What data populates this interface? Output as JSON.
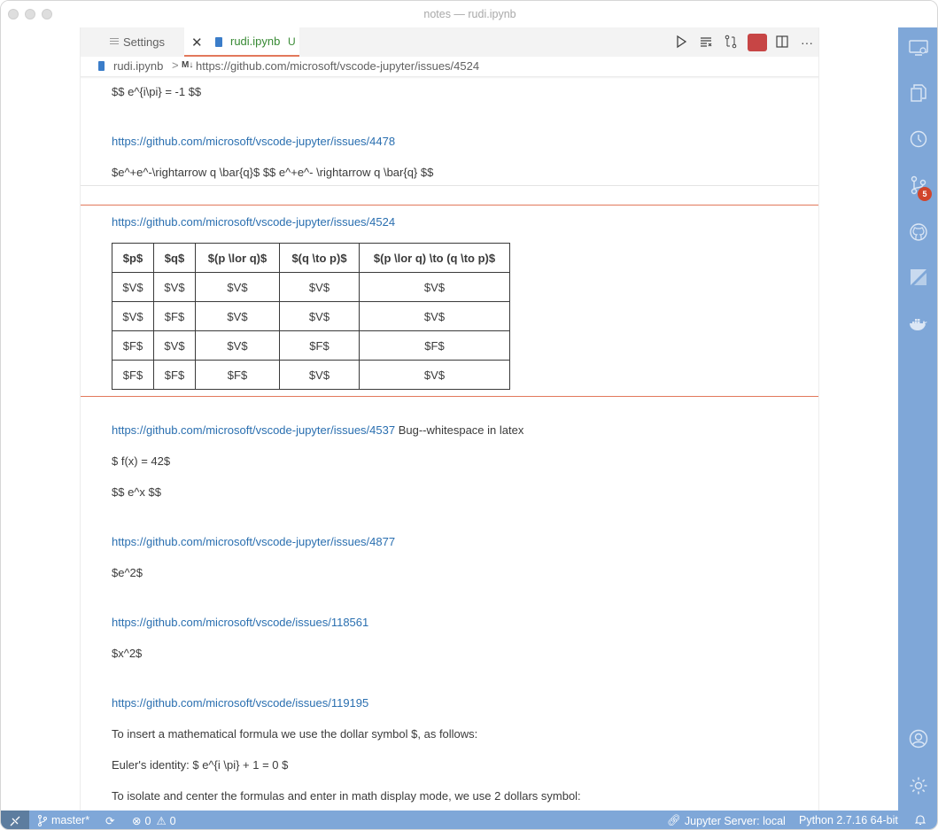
{
  "window": {
    "title": "notes — rudi.ipynb"
  },
  "tabs": [
    {
      "label": "Settings"
    },
    {
      "label": "rudi.ipynb",
      "badge": "U"
    }
  ],
  "breadcrumb": {
    "file": "rudi.ipynb",
    "separator": ">",
    "md_icon": "M↓",
    "path": "https://github.com/microsoft/vscode-jupyter/issues/4524"
  },
  "cells": {
    "c1_line1": "$$ e^{i\\pi} = -1 $$",
    "c1_link": "https://github.com/microsoft/vscode-jupyter/issues/4478",
    "c1_line2": "$e^+e^-\\rightarrow q \\bar{q}$ $$ e^+e^- \\rightarrow q \\bar{q} $$",
    "c2_link": "https://github.com/microsoft/vscode-jupyter/issues/4524",
    "table": {
      "headers": [
        "$p$",
        "$q$",
        "$(p \\lor q)$",
        "$(q \\to p)$",
        "$(p \\lor q) \\to (q \\to p)$"
      ],
      "rows": [
        [
          "$V$",
          "$V$",
          "$V$",
          "$V$",
          "$V$"
        ],
        [
          "$V$",
          "$F$",
          "$V$",
          "$V$",
          "$V$"
        ],
        [
          "$F$",
          "$V$",
          "$V$",
          "$F$",
          "$F$"
        ],
        [
          "$F$",
          "$F$",
          "$F$",
          "$V$",
          "$V$"
        ]
      ]
    },
    "c3_link": "https://github.com/microsoft/vscode-jupyter/issues/4537",
    "c3_link_suffix": " Bug--whitespace in latex",
    "c3_line1": "$ f(x) = 42$",
    "c3_line2": "$$ e^x $$",
    "c4_link": "https://github.com/microsoft/vscode-jupyter/issues/4877",
    "c4_line1": "$e^2$",
    "c5_link": "https://github.com/microsoft/vscode/issues/118561",
    "c5_line1": "$x^2$",
    "c6_link": "https://github.com/microsoft/vscode/issues/119195",
    "c6_line1": "To insert a mathematical formula we use the dollar symbol $, as follows:",
    "c6_line2": "Euler's identity: $ e^{i \\pi} + 1 = 0 $",
    "c6_line3": "To isolate and center the formulas and enter in math display mode, we use 2 dollars symbol:"
  },
  "activity_bar": {
    "scm_badge": "5",
    "icons": [
      "remote-explorer-icon",
      "explorer-icon",
      "timeline-icon",
      "source-control-icon",
      "github-icon",
      "extensions-icon",
      "docker-icon",
      "account-icon",
      "settings-gear-icon"
    ]
  },
  "statusbar": {
    "branch": "master*",
    "errors": "0",
    "warnings": "0",
    "jupyter": "Jupyter Server: local",
    "python": "Python 2.7.16 64-bit"
  },
  "colors": {
    "activity_bar": "#7fa7d8",
    "link": "#2a6fb0",
    "cell_focus_border": "#e2785b",
    "stop_button": "#c74545",
    "badge": "#d1452b",
    "modified": "#388a34"
  }
}
